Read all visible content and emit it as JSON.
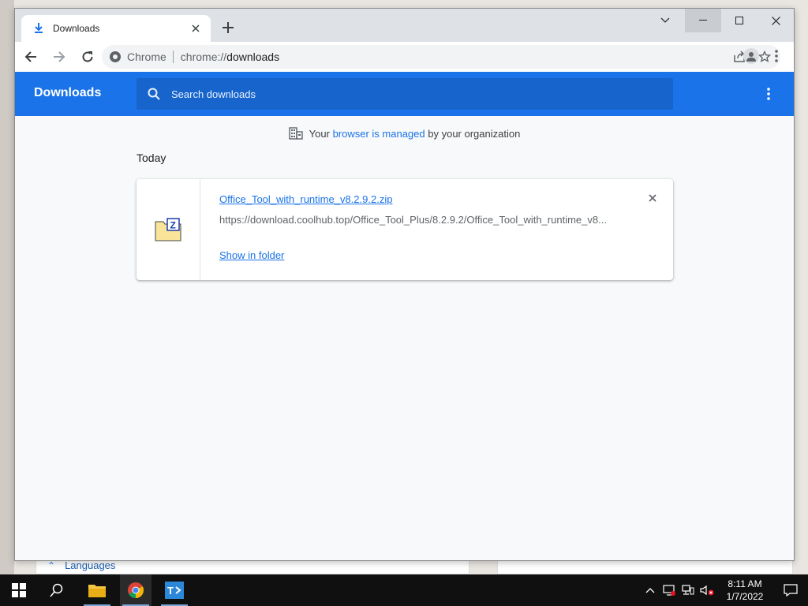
{
  "browser": {
    "tab_title": "Downloads",
    "omnibox_chip": "Chrome",
    "url_scheme": "chrome://",
    "url_host": "downloads"
  },
  "downloads_page": {
    "header_title": "Downloads",
    "search_placeholder": "Search downloads",
    "managed_prefix": "Your",
    "managed_link": "browser is managed",
    "managed_suffix": "by your organization",
    "section_date": "Today",
    "items": [
      {
        "file_name": "Office_Tool_with_runtime_v8.2.9.2.zip",
        "url": "https://download.coolhub.top/Office_Tool_Plus/8.2.9.2/Office_Tool_with_runtime_v8...",
        "action_label": "Show in folder"
      }
    ]
  },
  "background": {
    "languages_label": "Languages"
  },
  "taskbar": {
    "time": "8:11 AM",
    "date": "1/7/2022"
  },
  "colors": {
    "accent": "#1a73e8",
    "header_bg": "#1a73e8",
    "search_bg": "#1765cc",
    "taskbar_bg": "#101010"
  }
}
